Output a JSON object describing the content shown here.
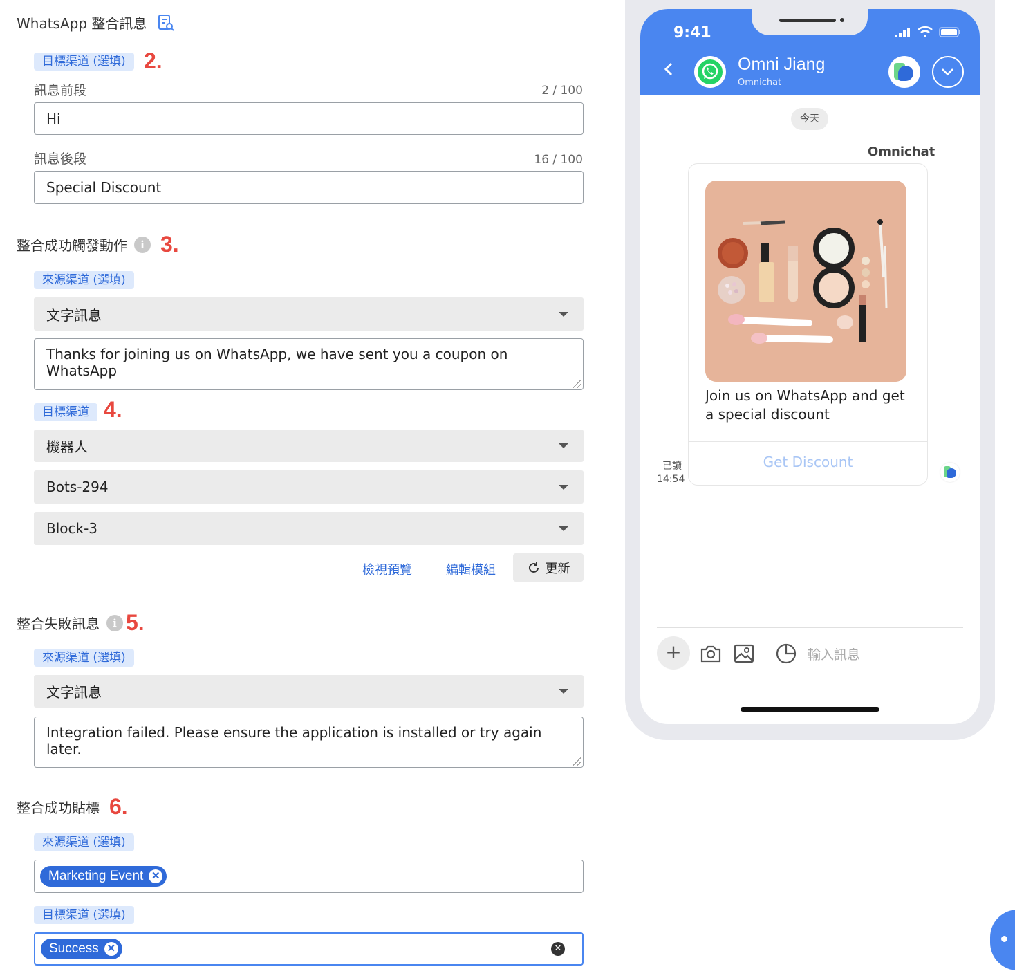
{
  "section1": {
    "title": "WhatsApp 整合訊息",
    "icon": "document-search-icon"
  },
  "section2": {
    "number": "2.",
    "chip": "目標渠道 (選填)",
    "prefix_label": "訊息前段",
    "prefix_count": "2 / 100",
    "prefix_value": "Hi",
    "suffix_label": "訊息後段",
    "suffix_count": "16 / 100",
    "suffix_value": "Special Discount"
  },
  "section3": {
    "title": "整合成功觸發動作",
    "number": "3.",
    "source_chip": "來源渠道 (選填)",
    "source_select": "文字訊息",
    "source_text": "Thanks for joining us on WhatsApp, we have sent you a coupon on WhatsApp",
    "number4": "4.",
    "target_chip": "目標渠道",
    "target_select": "機器人",
    "bot_select": "Bots-294",
    "block_select": "Block-3",
    "preview_link": "檢視預覽",
    "edit_link": "編輯模組",
    "refresh_button": "更新"
  },
  "section5": {
    "title": "整合失敗訊息",
    "number": "5.",
    "source_chip": "來源渠道 (選填)",
    "select": "文字訊息",
    "text": "Integration failed. Please ensure the application is installed or try again later."
  },
  "section6": {
    "title": "整合成功貼標",
    "number": "6.",
    "source_chip": "來源渠道 (選填)",
    "source_tag": "Marketing Event",
    "target_chip": "目標渠道 (選填)",
    "target_tag": "Success"
  },
  "phone": {
    "time": "9:41",
    "contact_name": "Omni Jiang",
    "contact_sub": "Omnichat",
    "date_badge": "今天",
    "sender": "Omnichat",
    "card_text": "Join us on WhatsApp and get a special discount",
    "card_button": "Get Discount",
    "read_label": "已讀",
    "read_time": "14:54",
    "input_placeholder": "輸入訊息",
    "colors": {
      "header": "#4a86f0",
      "whatsapp": "#25d366",
      "accent": "#2f6ad9"
    }
  }
}
